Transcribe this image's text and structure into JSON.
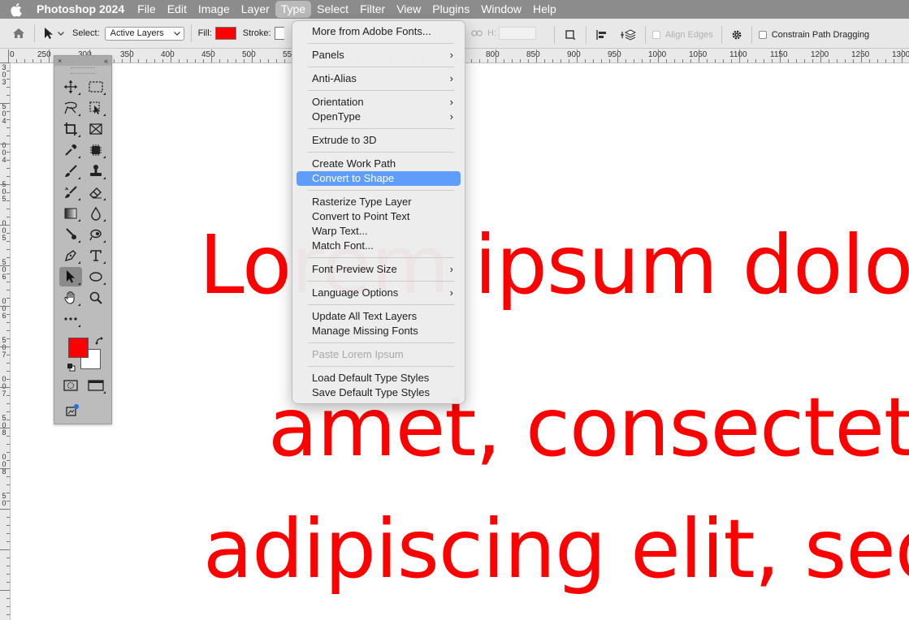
{
  "menubar": {
    "app_name": "Photoshop 2024",
    "items": [
      "File",
      "Edit",
      "Image",
      "Layer",
      "Type",
      "Select",
      "Filter",
      "View",
      "Plugins",
      "Window",
      "Help"
    ],
    "active_item": "Type"
  },
  "options_bar": {
    "select_label": "Select:",
    "select_value": "Active Layers",
    "fill_label": "Fill:",
    "stroke_label": "Stroke:",
    "fill_color": "#ff0000",
    "h_label": "H:",
    "align_edges_label": "Align Edges",
    "constrain_label": "Constrain Path Dragging"
  },
  "ruler": {
    "top_labels": [
      "0",
      "250",
      "300",
      "350",
      "400",
      "450",
      "500",
      "55",
      "800",
      "850",
      "900",
      "950",
      "1000",
      "1050",
      "1100",
      "1150",
      "1200",
      "1250",
      "1300"
    ],
    "left_labels": [
      "3",
      "0",
      "3",
      "5",
      "0",
      "4",
      "0",
      "0",
      "4",
      "5",
      "0",
      "5",
      "0",
      "0",
      "5",
      "5",
      "0",
      "6",
      "0",
      "0",
      "6",
      "5",
      "0",
      "7",
      "0",
      "0",
      "7",
      "5",
      "0",
      "8",
      "0",
      "0",
      "8",
      "5",
      "0"
    ]
  },
  "canvas": {
    "text_color": "#ff0000",
    "lines": [
      "Lorem ipsum dolor sit",
      "amet, consectetur",
      "adipiscing elit, sed do"
    ]
  },
  "tools_panel": {
    "close_glyph": "×",
    "collapse_glyph": "«",
    "foreground_color": "#ff0000",
    "background_color": "#ffffff"
  },
  "type_menu": {
    "groups": [
      [
        {
          "label": "More from Adobe Fonts...",
          "submenu": false
        }
      ],
      [
        {
          "label": "Panels",
          "submenu": true
        }
      ],
      [
        {
          "label": "Anti-Alias",
          "submenu": true
        }
      ],
      [
        {
          "label": "Orientation",
          "submenu": true
        },
        {
          "label": "OpenType",
          "submenu": true
        }
      ],
      [
        {
          "label": "Extrude to 3D",
          "submenu": false
        }
      ],
      [
        {
          "label": "Create Work Path",
          "submenu": false
        },
        {
          "label": "Convert to Shape",
          "submenu": false,
          "highlighted": true
        }
      ],
      [
        {
          "label": "Rasterize Type Layer",
          "submenu": false
        },
        {
          "label": "Convert to Point Text",
          "submenu": false
        },
        {
          "label": "Warp Text...",
          "submenu": false
        },
        {
          "label": "Match Font...",
          "submenu": false
        }
      ],
      [
        {
          "label": "Font Preview Size",
          "submenu": true
        }
      ],
      [
        {
          "label": "Language Options",
          "submenu": true
        }
      ],
      [
        {
          "label": "Update All Text Layers",
          "submenu": false
        },
        {
          "label": "Manage Missing Fonts",
          "submenu": false
        }
      ],
      [
        {
          "label": "Paste Lorem Ipsum",
          "submenu": false,
          "disabled": true
        }
      ],
      [
        {
          "label": "Load Default Type Styles",
          "submenu": false
        },
        {
          "label": "Save Default Type Styles",
          "submenu": false
        }
      ]
    ],
    "submenu_glyph": "›",
    "highlight_color": "#5e9efa"
  }
}
